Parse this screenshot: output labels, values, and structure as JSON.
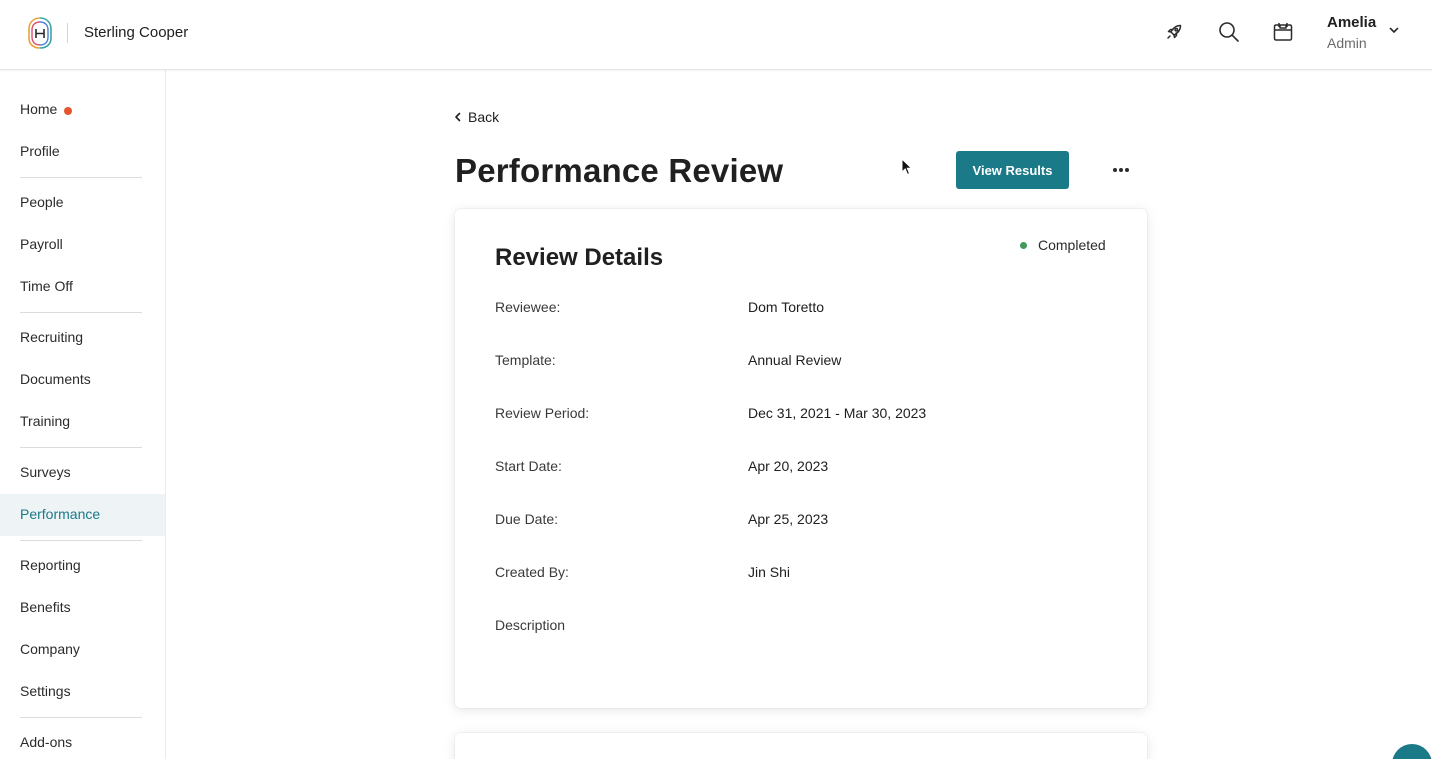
{
  "header": {
    "company_name": "Sterling Cooper",
    "logo_icon": "fingerprint-h-logo",
    "icons": [
      "rocket-icon",
      "search-icon",
      "calendar-icon"
    ],
    "user": {
      "name": "Amelia",
      "role": "Admin"
    }
  },
  "sidebar": {
    "items": [
      {
        "label": "Home",
        "badge": true
      },
      {
        "label": "Profile"
      },
      {
        "label": "People"
      },
      {
        "label": "Payroll"
      },
      {
        "label": "Time Off"
      },
      {
        "label": "Recruiting"
      },
      {
        "label": "Documents"
      },
      {
        "label": "Training"
      },
      {
        "label": "Surveys"
      },
      {
        "label": "Performance",
        "active": true
      },
      {
        "label": "Reporting"
      },
      {
        "label": "Benefits"
      },
      {
        "label": "Company"
      },
      {
        "label": "Settings"
      },
      {
        "label": "Add-ons"
      }
    ]
  },
  "main": {
    "back_label": "Back",
    "title": "Performance Review",
    "view_results_label": "View Results",
    "card": {
      "title": "Review Details",
      "status": "Completed",
      "rows": [
        {
          "key": "Reviewee:",
          "value": "Dom Toretto"
        },
        {
          "key": "Template:",
          "value": "Annual Review"
        },
        {
          "key": "Review Period:",
          "value": "Dec 31, 2021 - Mar 30, 2023"
        },
        {
          "key": "Start Date:",
          "value": "Apr 20, 2023"
        },
        {
          "key": "Due Date:",
          "value": "Apr 25, 2023"
        },
        {
          "key": "Created By:",
          "value": "Jin Shi"
        },
        {
          "key": "Description",
          "value": ""
        }
      ]
    }
  },
  "colors": {
    "accent": "#1b7a87",
    "active_nav_bg": "#eef3f5",
    "notification_dot": "#e4572e",
    "status_completed": "#3f9a5b"
  }
}
